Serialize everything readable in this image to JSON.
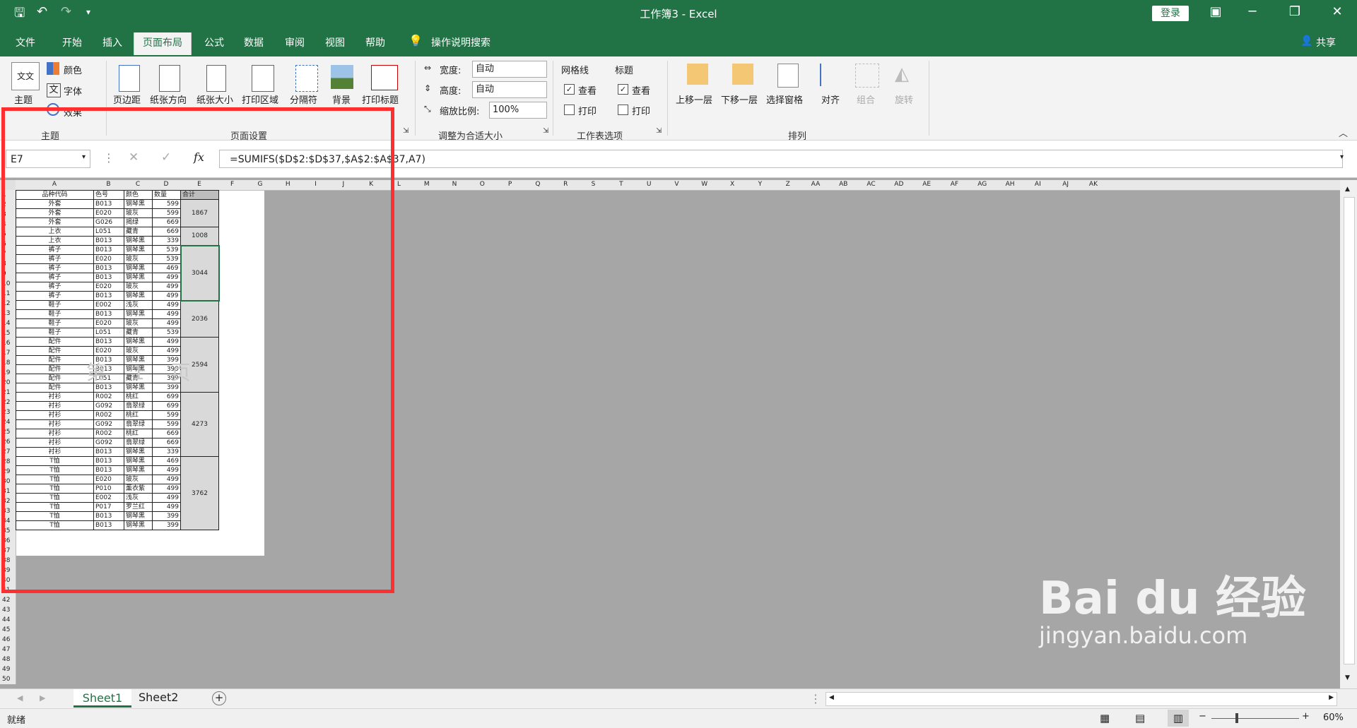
{
  "window": {
    "title": "工作簿3  -  Excel",
    "login": "登录",
    "share": "共享"
  },
  "tabs": [
    "文件",
    "开始",
    "插入",
    "页面布局",
    "公式",
    "数据",
    "审阅",
    "视图",
    "帮助"
  ],
  "active_tab": "页面布局",
  "search": "操作说明搜索",
  "ribbon": {
    "theme": {
      "theme": "主题",
      "colors": "颜色",
      "fonts": "字体",
      "effects": "效果",
      "group": "主题"
    },
    "page_setup": {
      "margins": "页边距",
      "orientation": "纸张方向",
      "size": "纸张大小",
      "print_area": "打印区域",
      "breaks": "分隔符",
      "background": "背景",
      "print_titles": "打印标题",
      "group": "页面设置"
    },
    "scale": {
      "width_label": "宽度:",
      "width_value": "自动",
      "height_label": "高度:",
      "height_value": "自动",
      "scale_label": "缩放比例:",
      "scale_value": "100%",
      "group": "调整为合适大小"
    },
    "sheet_options": {
      "gridlines": "网格线",
      "headings": "标题",
      "view": "查看",
      "print": "打印",
      "group": "工作表选项"
    },
    "arrange": {
      "bring_forward": "上移一层",
      "send_backward": "下移一层",
      "selection_pane": "选择窗格",
      "align": "对齐",
      "group_btn": "组合",
      "rotate": "旋转",
      "group": "排列"
    }
  },
  "formula_bar": {
    "name_box": "E7",
    "fx": "fx",
    "formula": "=SUMIFS($D$2:$D$37,$A$2:$A$37,A7)"
  },
  "columns": [
    "A",
    "B",
    "C",
    "D",
    "E",
    "F",
    "G",
    "H",
    "I",
    "J",
    "K",
    "L",
    "M",
    "N",
    "O",
    "P",
    "Q",
    "R",
    "S",
    "T",
    "U",
    "V",
    "W",
    "X",
    "Y",
    "Z",
    "AA",
    "AB",
    "AC",
    "AD",
    "AE",
    "AF",
    "AG",
    "AH",
    "AI",
    "AJ",
    "AK"
  ],
  "header_row": [
    "品种代码",
    "色号",
    "颜色",
    "数量",
    "合计"
  ],
  "rows": [
    [
      "外套",
      "B013",
      "钢琴黑",
      "599"
    ],
    [
      "外套",
      "E020",
      "玻灰",
      "599"
    ],
    [
      "外套",
      "G026",
      "揭绿",
      "669"
    ],
    [
      "上衣",
      "L051",
      "藏青",
      "669"
    ],
    [
      "上衣",
      "B013",
      "钢琴黑",
      "339"
    ],
    [
      "裤子",
      "B013",
      "钢琴黑",
      "539"
    ],
    [
      "裤子",
      "E020",
      "玻灰",
      "539"
    ],
    [
      "裤子",
      "B013",
      "钢琴黑",
      "469"
    ],
    [
      "裤子",
      "B013",
      "钢琴黑",
      "499"
    ],
    [
      "裤子",
      "E020",
      "玻灰",
      "499"
    ],
    [
      "裤子",
      "B013",
      "钢琴黑",
      "499"
    ],
    [
      "鞋子",
      "E002",
      "浅灰",
      "499"
    ],
    [
      "鞋子",
      "B013",
      "钢琴黑",
      "499"
    ],
    [
      "鞋子",
      "E020",
      "玻灰",
      "499"
    ],
    [
      "鞋子",
      "L051",
      "藏青",
      "539"
    ],
    [
      "配件",
      "B013",
      "钢琴黑",
      "499"
    ],
    [
      "配件",
      "E020",
      "玻灰",
      "499"
    ],
    [
      "配件",
      "B013",
      "钢琴黑",
      "399"
    ],
    [
      "配件",
      "B013",
      "钢琴黑",
      "399"
    ],
    [
      "配件",
      "L051",
      "藏青",
      "399"
    ],
    [
      "配件",
      "B013",
      "钢琴黑",
      "399"
    ],
    [
      "衬衫",
      "R002",
      "桃红",
      "699"
    ],
    [
      "衬衫",
      "G092",
      "翡翠绿",
      "699"
    ],
    [
      "衬衫",
      "R002",
      "桃红",
      "599"
    ],
    [
      "衬衫",
      "G092",
      "翡翠绿",
      "599"
    ],
    [
      "衬衫",
      "R002",
      "桃红",
      "669"
    ],
    [
      "衬衫",
      "G092",
      "翡翠绿",
      "669"
    ],
    [
      "衬衫",
      "B013",
      "钢琴黑",
      "339"
    ],
    [
      "T恤",
      "B013",
      "钢琴黑",
      "469"
    ],
    [
      "T恤",
      "B013",
      "钢琴黑",
      "499"
    ],
    [
      "T恤",
      "E020",
      "玻灰",
      "499"
    ],
    [
      "T恤",
      "P010",
      "薰衣紫",
      "499"
    ],
    [
      "T恤",
      "E002",
      "浅灰",
      "499"
    ],
    [
      "T恤",
      "P017",
      "罗兰红",
      "499"
    ],
    [
      "T恤",
      "B013",
      "钢琴黑",
      "399"
    ],
    [
      "T恤",
      "B013",
      "钢琴黑",
      "399"
    ]
  ],
  "totals": [
    {
      "value": "1867",
      "span": 3
    },
    {
      "value": "1008",
      "span": 2
    },
    {
      "value": "3044",
      "span": 6
    },
    {
      "value": "2036",
      "span": 4
    },
    {
      "value": "2594",
      "span": 6
    },
    {
      "value": "4273",
      "span": 7
    },
    {
      "value": "3762",
      "span": 8
    }
  ],
  "page_watermark": "第 1 页",
  "sheet_tabs": [
    "Sheet1",
    "Sheet2"
  ],
  "status": {
    "ready": "就绪",
    "zoom": "60%"
  },
  "brand_watermark": {
    "logo": "Bai du 经验",
    "url": "jingyan.baidu.com"
  },
  "colors": {
    "excel_green": "#217346",
    "highlight": "#ff2f2f"
  }
}
